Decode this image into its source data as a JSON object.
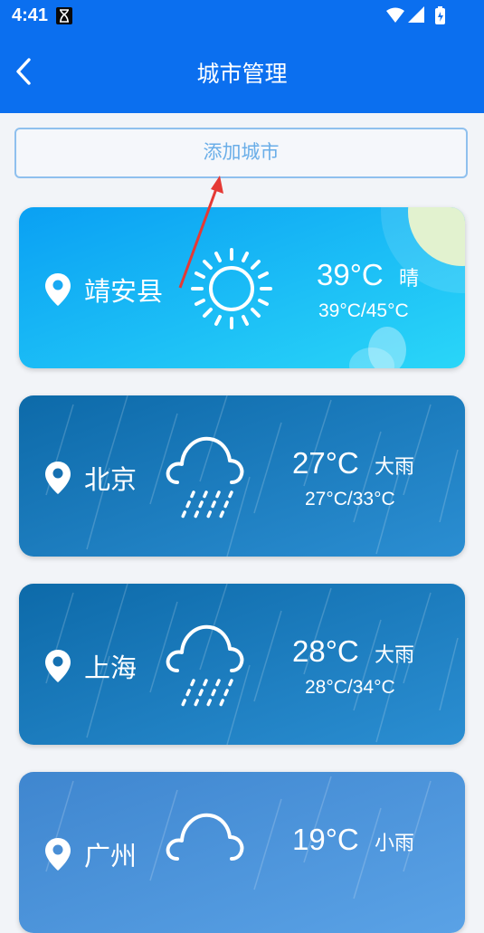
{
  "status_bar": {
    "time": "4:41"
  },
  "header": {
    "title": "城市管理"
  },
  "add_city_label": "添加城市",
  "cities": [
    {
      "name": "靖安县",
      "temp": "39°C",
      "condition": "晴",
      "range": "39°C/45°C",
      "icon": "sun-icon"
    },
    {
      "name": "北京",
      "temp": "27°C",
      "condition": "大雨",
      "range": "27°C/33°C",
      "icon": "heavy-rain-icon"
    },
    {
      "name": "上海",
      "temp": "28°C",
      "condition": "大雨",
      "range": "28°C/34°C",
      "icon": "heavy-rain-icon"
    },
    {
      "name": "广州",
      "temp": "19°C",
      "condition": "小雨",
      "range": "",
      "icon": "light-rain-icon"
    }
  ],
  "colors": {
    "primary": "#0b6fef",
    "sunny_card": "#1ab8f5",
    "rain_card": "#1f7ec2",
    "light_rain_card": "#4f93dc",
    "annotation_arrow": "#e53935"
  }
}
